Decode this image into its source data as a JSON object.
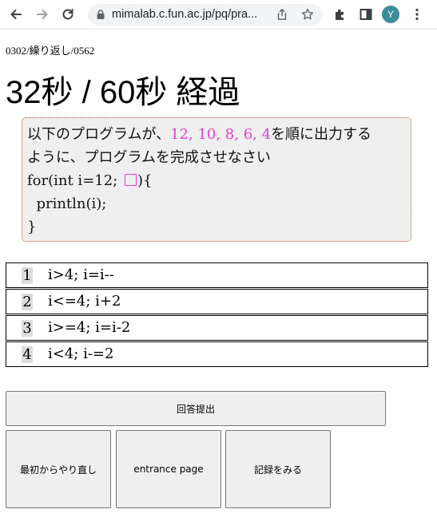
{
  "browser": {
    "url": "mimalab.c.fun.ac.jp/pq/pra...",
    "profile_initial": "Y"
  },
  "page": {
    "breadcrumb": "0302/繰り返し/0562",
    "timer": "32秒 / 60秒 経過"
  },
  "question": {
    "line1_prefix": "以下のプログラムが、",
    "line1_sequence": "12, 10, 8, 6, 4",
    "line1_suffix": "を順に出力する",
    "line2": "ように、プログラムを完成させなさい",
    "line3_prefix": "for(int i=12; ",
    "line3_suffix": "){",
    "line4": "  println(i);",
    "line5": "}"
  },
  "choices": [
    {
      "num": "1",
      "text": "i>4; i=i--"
    },
    {
      "num": "2",
      "text": "i<=4; i+2"
    },
    {
      "num": "3",
      "text": "i>=4; i=i-2"
    },
    {
      "num": "4",
      "text": "i<4; i-=2"
    }
  ],
  "buttons": {
    "submit": "回答提出",
    "restart": "最初からやり直し",
    "entrance": "entrance page",
    "records": "記録をみる"
  },
  "colors": {
    "highlight": "#e040d0",
    "question_border": "#c0532d",
    "avatar": "#3b8d99"
  }
}
